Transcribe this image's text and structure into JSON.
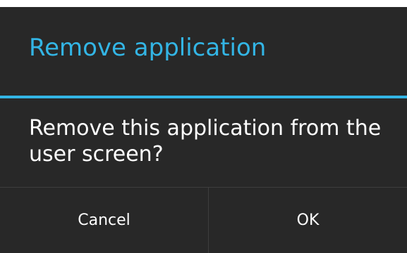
{
  "dialog": {
    "title": "Remove application",
    "message": "Remove this application from the user screen?",
    "buttons": {
      "cancel_label": "Cancel",
      "ok_label": "OK"
    }
  },
  "colors": {
    "accent": "#33b5e5",
    "dialog_background": "#282828",
    "text": "#ffffff",
    "divider": "#3e3e3e"
  }
}
